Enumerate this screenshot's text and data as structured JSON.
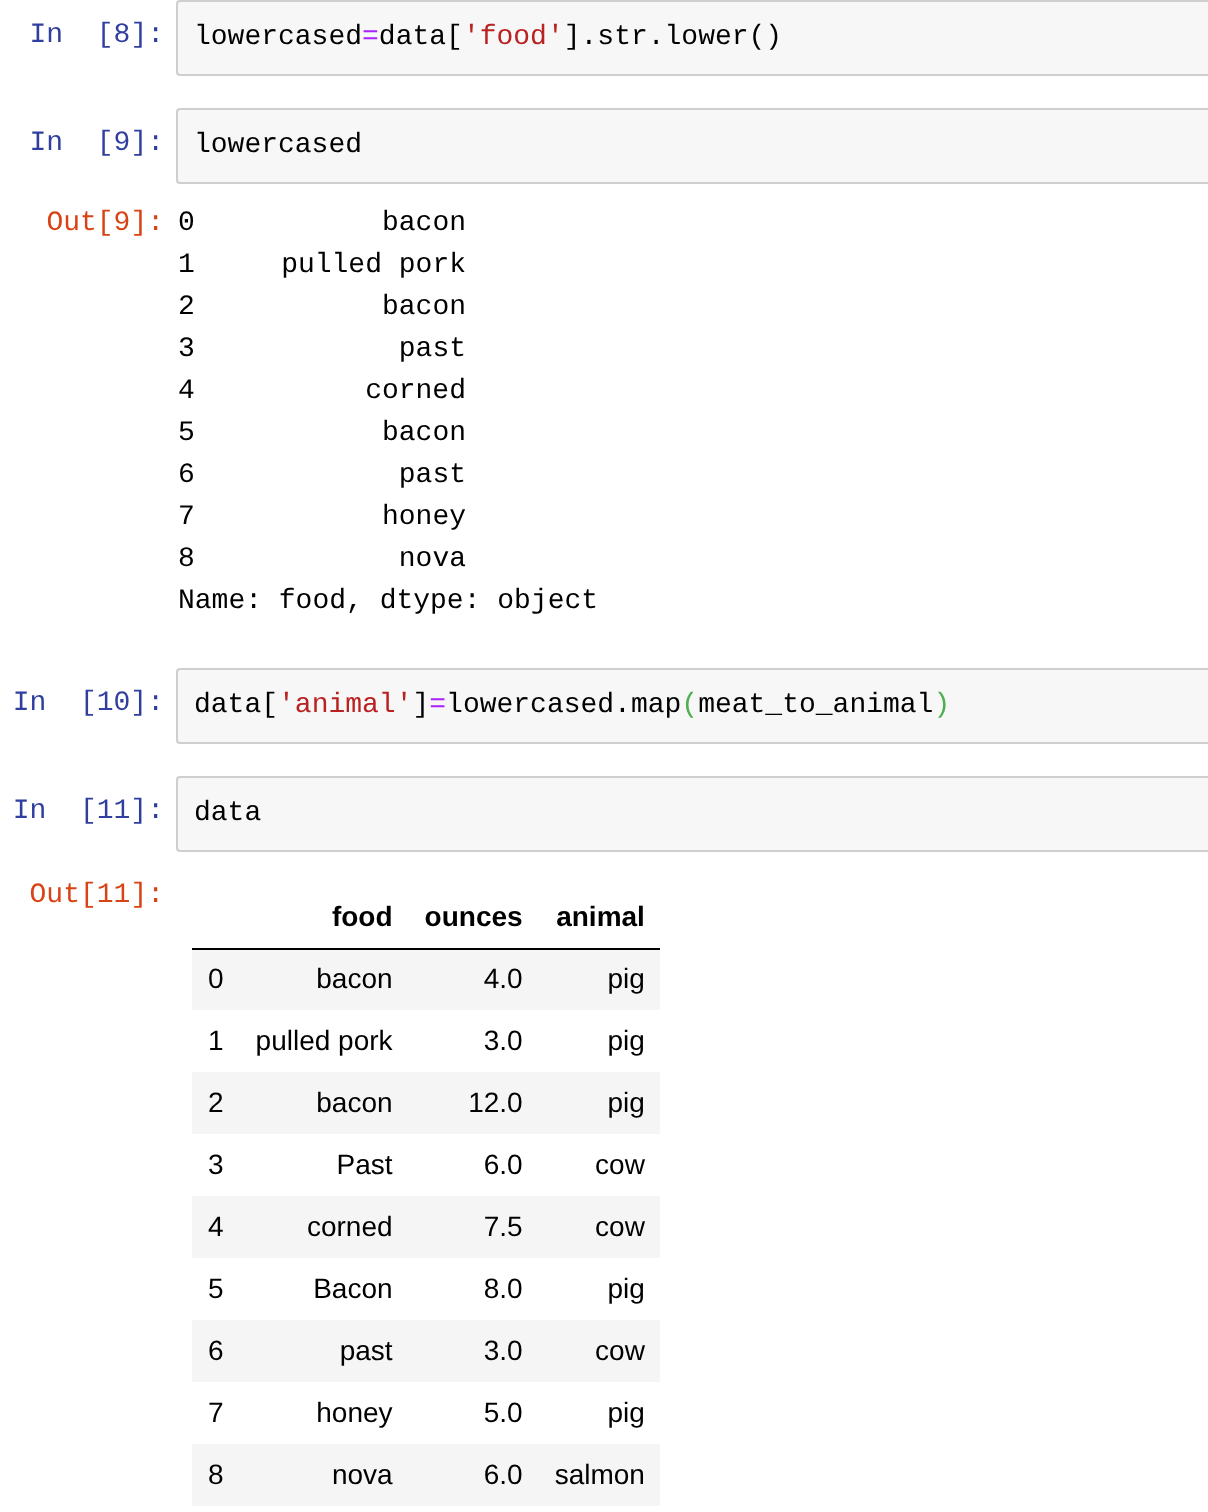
{
  "cells": [
    {
      "kind": "code",
      "prompt": "In  [8]:",
      "code": [
        {
          "kind": "text",
          "text": "lowercased"
        },
        {
          "kind": "operator",
          "text": "="
        },
        {
          "kind": "text",
          "text": "data["
        },
        {
          "kind": "string",
          "text": "'food'"
        },
        {
          "kind": "text",
          "text": "].str.lower()"
        }
      ]
    },
    {
      "kind": "code",
      "prompt": "In  [9]:",
      "code": [
        {
          "kind": "text",
          "text": "lowercased"
        }
      ]
    },
    {
      "kind": "series",
      "prompt": "Out[9]:",
      "rows": [
        {
          "index": "0",
          "value": "bacon"
        },
        {
          "index": "1",
          "value": "pulled pork"
        },
        {
          "index": "2",
          "value": "bacon"
        },
        {
          "index": "3",
          "value": "past"
        },
        {
          "index": "4",
          "value": "corned"
        },
        {
          "index": "5",
          "value": "bacon"
        },
        {
          "index": "6",
          "value": "past"
        },
        {
          "index": "7",
          "value": "honey"
        },
        {
          "index": "8",
          "value": "nova"
        }
      ],
      "footer": "Name: food, dtype: object"
    },
    {
      "kind": "code",
      "prompt": "In  [10]:",
      "code": [
        {
          "kind": "text",
          "text": "data["
        },
        {
          "kind": "string",
          "text": "'animal'"
        },
        {
          "kind": "text",
          "text": "]"
        },
        {
          "kind": "operator",
          "text": "="
        },
        {
          "kind": "text",
          "text": "lowercased.map"
        },
        {
          "kind": "bracket",
          "text": "("
        },
        {
          "kind": "text",
          "text": "meat_to_animal"
        },
        {
          "kind": "bracket",
          "text": ")"
        }
      ]
    },
    {
      "kind": "code",
      "prompt": "In  [11]:",
      "code": [
        {
          "kind": "text",
          "text": "data"
        }
      ]
    },
    {
      "kind": "table",
      "prompt": "Out[11]:",
      "columns": [
        "",
        "food",
        "ounces",
        "animal"
      ],
      "rows": [
        [
          "0",
          "bacon",
          "4.0",
          "pig"
        ],
        [
          "1",
          "pulled pork",
          "3.0",
          "pig"
        ],
        [
          "2",
          "bacon",
          "12.0",
          "pig"
        ],
        [
          "3",
          "Past",
          "6.0",
          "cow"
        ],
        [
          "4",
          "corned",
          "7.5",
          "cow"
        ],
        [
          "5",
          "Bacon",
          "8.0",
          "pig"
        ],
        [
          "6",
          "past",
          "3.0",
          "cow"
        ],
        [
          "7",
          "honey",
          "5.0",
          "pig"
        ],
        [
          "8",
          "nova",
          "6.0",
          "salmon"
        ]
      ]
    }
  ]
}
